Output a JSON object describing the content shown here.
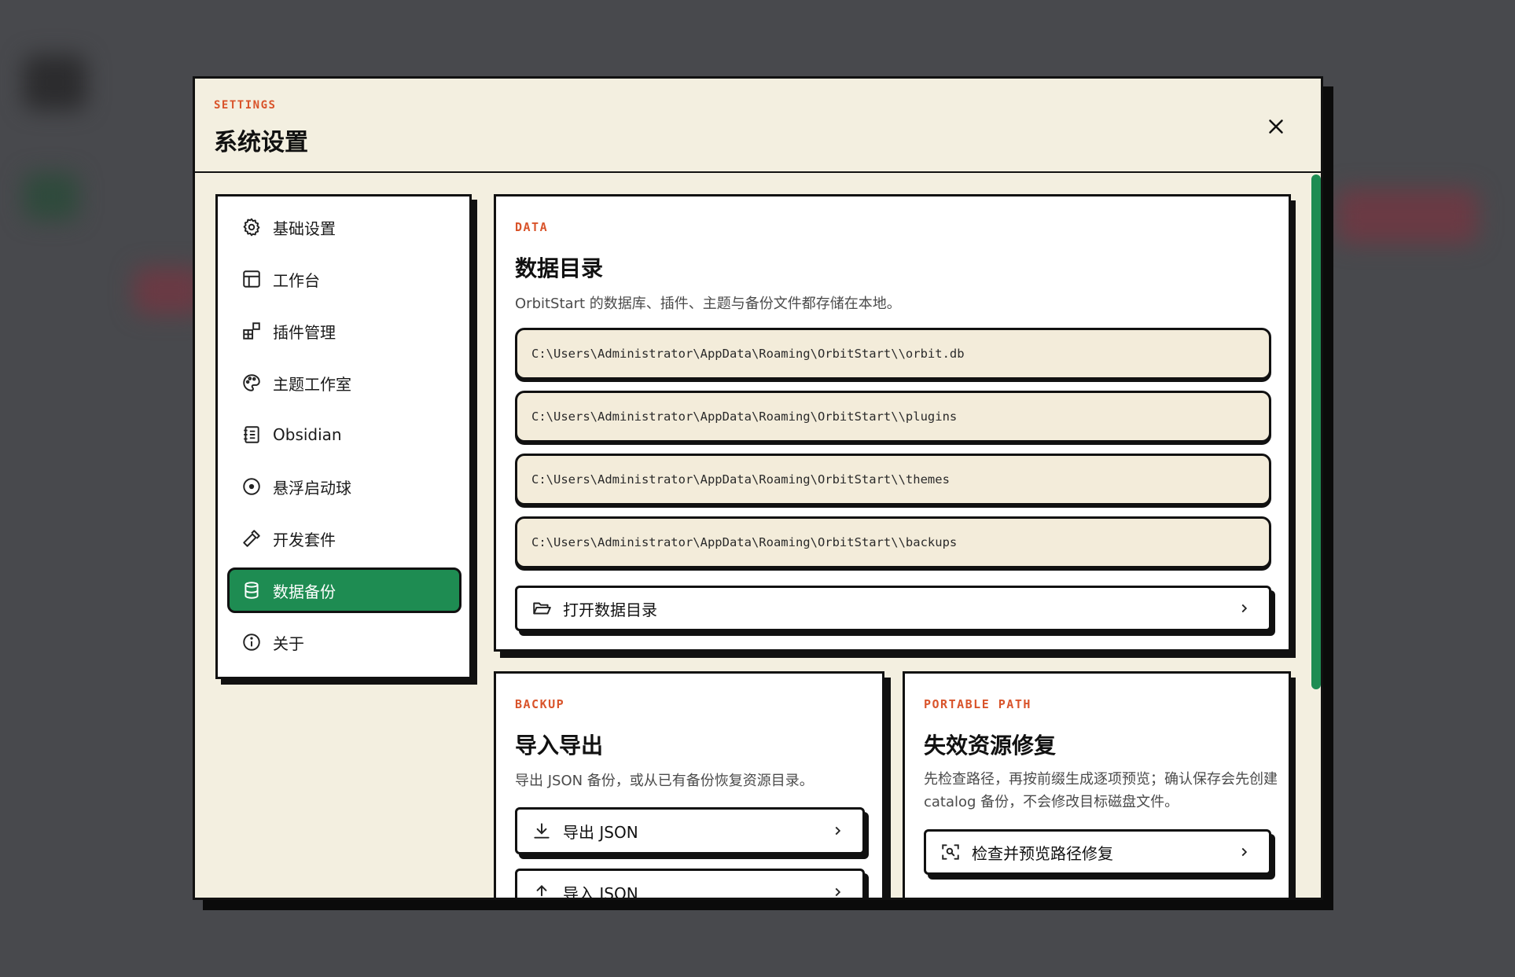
{
  "modal": {
    "eyebrow": "SETTINGS",
    "title": "系统设置"
  },
  "sidebar": {
    "items": [
      {
        "label": "基础设置",
        "icon": "gear-icon"
      },
      {
        "label": "工作台",
        "icon": "layout-icon"
      },
      {
        "label": "插件管理",
        "icon": "puzzle-icon"
      },
      {
        "label": "主题工作室",
        "icon": "palette-icon"
      },
      {
        "label": "Obsidian",
        "icon": "notebook-icon"
      },
      {
        "label": "悬浮启动球",
        "icon": "target-icon"
      },
      {
        "label": "开发套件",
        "icon": "hammer-icon"
      },
      {
        "label": "数据备份",
        "icon": "database-icon",
        "active": true
      },
      {
        "label": "关于",
        "icon": "info-icon"
      }
    ]
  },
  "data_card": {
    "eyebrow": "DATA",
    "title": "数据目录",
    "description": "OrbitStart 的数据库、插件、主题与备份文件都存储在本地。",
    "paths": [
      "C:\\Users\\Administrator\\AppData\\Roaming\\OrbitStart\\\\orbit.db",
      "C:\\Users\\Administrator\\AppData\\Roaming\\OrbitStart\\\\plugins",
      "C:\\Users\\Administrator\\AppData\\Roaming\\OrbitStart\\\\themes",
      "C:\\Users\\Administrator\\AppData\\Roaming\\OrbitStart\\\\backups"
    ],
    "open_button": "打开数据目录"
  },
  "backup_card": {
    "eyebrow": "BACKUP",
    "title": "导入导出",
    "description": "导出 JSON 备份，或从已有备份恢复资源目录。",
    "export_button": "导出 JSON",
    "import_button": "导入 JSON"
  },
  "portable_card": {
    "eyebrow": "PORTABLE PATH",
    "title": "失效资源修复",
    "description": "先检查路径，再按前缀生成逐项预览；确认保存会先创建 catalog 备份，不会修改目标磁盘文件。",
    "check_button": "检查并预览路径修复"
  },
  "colors": {
    "accent": "#1e8c52",
    "eyebrow": "#d9542b",
    "panel": "#f3efe0",
    "path_bg": "#f3ecda"
  }
}
